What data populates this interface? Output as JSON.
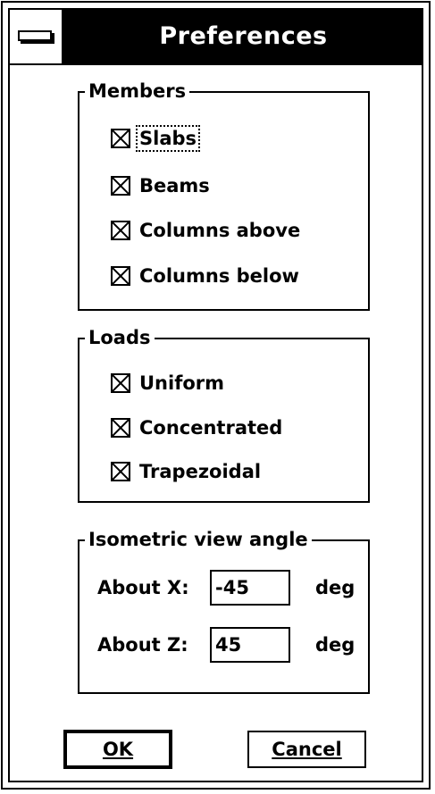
{
  "window": {
    "title": "Preferences"
  },
  "members": {
    "legend": "Members",
    "items": [
      {
        "label": "Slabs",
        "checked": true
      },
      {
        "label": "Beams",
        "checked": true
      },
      {
        "label": "Columns above",
        "checked": true
      },
      {
        "label": "Columns below",
        "checked": true
      }
    ]
  },
  "loads": {
    "legend": "Loads",
    "items": [
      {
        "label": "Uniform",
        "checked": true
      },
      {
        "label": "Concentrated",
        "checked": true
      },
      {
        "label": "Trapezoidal",
        "checked": true
      }
    ]
  },
  "iso": {
    "legend": "Isometric view angle",
    "x_label": "About X:",
    "x_value": "-45",
    "z_label": "About Z:",
    "z_value": "45",
    "unit": "deg"
  },
  "buttons": {
    "ok": "OK",
    "cancel": "Cancel"
  }
}
